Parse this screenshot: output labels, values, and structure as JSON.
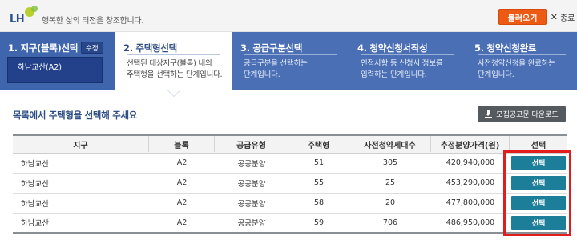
{
  "header": {
    "logo_text": "LH",
    "slogan": "행복한 삶의 터전을 창조합니다.",
    "load_button": "불러오기",
    "close_icon": "close-icon",
    "close_label": "종료",
    "brand_color": "#ec5a13"
  },
  "steps": [
    {
      "title": "1. 지구(블록)선택",
      "badge": "수정",
      "selected_item": "하남교산(A2)"
    },
    {
      "title": "2. 주택형선택",
      "desc_line1": "선택된 대상지구(블록) 내의",
      "desc_line2": "주택형을 선택하는 단계입니다."
    },
    {
      "title": "3. 공급구분선택",
      "desc_line1": "공급구분을 선택하는",
      "desc_line2": "단계입니다."
    },
    {
      "title": "4. 청약신청서작성",
      "desc_line1": "인적사항 등 신청서 정보를",
      "desc_line2": "입력하는 단계입니다."
    },
    {
      "title": "5. 청약신청완료",
      "desc_line1": "사전청약신청을 완료하는",
      "desc_line2": "단계입니다."
    }
  ],
  "main": {
    "section_title": "목록에서 주택형을 선택해 주세요",
    "download_button": "모집공고문 다운로드",
    "download_icon": "download-icon"
  },
  "table": {
    "headers": [
      "지구",
      "블록",
      "공급유형",
      "주택형",
      "사전청약세대수",
      "추정분양가격(원)",
      "선택"
    ],
    "rows": [
      {
        "district": "하남교산",
        "block": "A2",
        "type": "공공분양",
        "house_type": "51",
        "units": "305",
        "price": "420,940,000",
        "action": "선택"
      },
      {
        "district": "하남교산",
        "block": "A2",
        "type": "공공분양",
        "house_type": "55",
        "units": "25",
        "price": "453,290,000",
        "action": "선택"
      },
      {
        "district": "하남교산",
        "block": "A2",
        "type": "공공분양",
        "house_type": "58",
        "units": "20",
        "price": "477,800,000",
        "action": "선택"
      },
      {
        "district": "하남교산",
        "block": "A2",
        "type": "공공분양",
        "house_type": "59",
        "units": "706",
        "price": "486,950,000",
        "action": "선택"
      }
    ]
  },
  "colors": {
    "step_bar": "#4a6fb5",
    "select_button": "#1c7e98",
    "highlight_border": "#e11d1d"
  }
}
